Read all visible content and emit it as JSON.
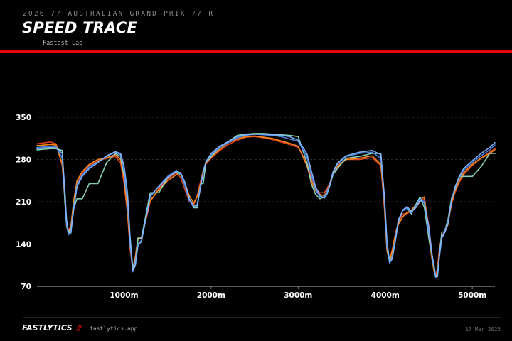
{
  "header": {
    "supertitle": "2026 // AUSTRALIAN GRAND PRIX // R",
    "title": "SPEED TRACE",
    "subtitle": "Fastest Lap"
  },
  "footer": {
    "brand": "FASTLYTICS",
    "separator": "//",
    "site": "fastlytics.app",
    "date": "17 Mar 2026"
  },
  "colors": {
    "background": "#000000",
    "accent": "#e10600",
    "grid": "#3a3a3a"
  },
  "chart_data": {
    "type": "line",
    "title": "",
    "xlabel": "",
    "ylabel": "",
    "xlim": [
      0,
      5260
    ],
    "ylim": [
      70,
      350
    ],
    "yticks": [
      70,
      140,
      210,
      280,
      350
    ],
    "xticks": [
      1000,
      2000,
      3000,
      4000,
      5000
    ],
    "xtick_labels": [
      "1000m",
      "2000m",
      "3000m",
      "4000m",
      "5000m"
    ],
    "grid": "horizontal dashed",
    "legend": "none",
    "series": [
      {
        "color": "#e8461e",
        "x": [
          0,
          150,
          220,
          290,
          320,
          340,
          360,
          390,
          420,
          460,
          520,
          600,
          700,
          800,
          900,
          960,
          1000,
          1040,
          1070,
          1100,
          1130,
          1160,
          1200,
          1300,
          1400,
          1500,
          1600,
          1650,
          1700,
          1750,
          1800,
          1840,
          1880,
          1910,
          1940,
          2000,
          2100,
          2200,
          2300,
          2400,
          2500,
          2600,
          2700,
          2800,
          2900,
          3000,
          3100,
          3150,
          3200,
          3250,
          3300,
          3330,
          3360,
          3400,
          3450,
          3550,
          3700,
          3850,
          3950,
          3990,
          4020,
          4050,
          4080,
          4120,
          4150,
          4200,
          4250,
          4300,
          4350,
          4400,
          4450,
          4500,
          4540,
          4560,
          4580,
          4600,
          4620,
          4650,
          4680,
          4720,
          4760,
          4800,
          4850,
          4900,
          5000,
          5100,
          5200,
          5260
        ],
        "values": [
          306,
          309,
          306,
          270,
          215,
          180,
          162,
          170,
          205,
          240,
          258,
          270,
          278,
          282,
          285,
          275,
          240,
          190,
          130,
          100,
          120,
          150,
          148,
          210,
          232,
          248,
          258,
          250,
          230,
          210,
          205,
          220,
          245,
          262,
          272,
          282,
          295,
          305,
          312,
          317,
          318,
          316,
          313,
          309,
          305,
          300,
          275,
          250,
          232,
          225,
          225,
          232,
          240,
          258,
          270,
          280,
          280,
          283,
          270,
          200,
          130,
          115,
          130,
          160,
          175,
          190,
          190,
          195,
          200,
          210,
          215,
          170,
          120,
          100,
          88,
          100,
          130,
          155,
          160,
          175,
          205,
          225,
          242,
          255,
          270,
          282,
          292,
          298
        ]
      },
      {
        "color": "#ff8c1a",
        "x": [
          0,
          150,
          220,
          290,
          320,
          340,
          360,
          390,
          420,
          460,
          520,
          600,
          700,
          800,
          900,
          960,
          1000,
          1040,
          1070,
          1100,
          1130,
          1160,
          1200,
          1300,
          1400,
          1500,
          1600,
          1650,
          1700,
          1750,
          1800,
          1840,
          1880,
          1910,
          1940,
          2000,
          2100,
          2200,
          2300,
          2400,
          2500,
          2600,
          2700,
          2800,
          2900,
          3000,
          3100,
          3150,
          3200,
          3250,
          3300,
          3330,
          3360,
          3400,
          3450,
          3550,
          3700,
          3850,
          3950,
          3990,
          4020,
          4050,
          4080,
          4120,
          4150,
          4200,
          4250,
          4300,
          4350,
          4400,
          4450,
          4500,
          4540,
          4560,
          4580,
          4600,
          4620,
          4650,
          4680,
          4720,
          4760,
          4800,
          4850,
          4900,
          5000,
          5100,
          5200,
          5260
        ],
        "values": [
          303,
          305,
          304,
          273,
          220,
          178,
          160,
          168,
          210,
          245,
          260,
          272,
          280,
          283,
          288,
          280,
          250,
          195,
          135,
          98,
          115,
          148,
          150,
          212,
          230,
          245,
          255,
          258,
          240,
          220,
          208,
          218,
          240,
          262,
          275,
          284,
          297,
          308,
          314,
          318,
          319,
          317,
          315,
          311,
          307,
          302,
          270,
          245,
          228,
          222,
          220,
          228,
          238,
          256,
          268,
          280,
          282,
          286,
          272,
          205,
          128,
          112,
          128,
          158,
          172,
          185,
          192,
          196,
          205,
          213,
          218,
          150,
          112,
          95,
          86,
          92,
          125,
          150,
          158,
          172,
          208,
          228,
          245,
          258,
          272,
          282,
          290,
          296
        ]
      },
      {
        "color": "#8fd9c0",
        "x": [
          0,
          150,
          220,
          290,
          320,
          340,
          360,
          390,
          420,
          460,
          520,
          600,
          700,
          800,
          900,
          960,
          1000,
          1040,
          1070,
          1100,
          1130,
          1160,
          1200,
          1300,
          1400,
          1500,
          1600,
          1650,
          1700,
          1750,
          1800,
          1840,
          1880,
          1910,
          1940,
          2000,
          2100,
          2200,
          2300,
          2400,
          2500,
          2600,
          2700,
          2800,
          2900,
          3000,
          3100,
          3150,
          3200,
          3250,
          3300,
          3330,
          3360,
          3400,
          3450,
          3550,
          3700,
          3850,
          3950,
          3990,
          4020,
          4050,
          4080,
          4120,
          4150,
          4200,
          4250,
          4300,
          4350,
          4400,
          4450,
          4500,
          4540,
          4560,
          4580,
          4600,
          4620,
          4650,
          4680,
          4720,
          4760,
          4800,
          4850,
          4900,
          5000,
          5100,
          5200,
          5260
        ],
        "values": [
          296,
          298,
          298,
          295,
          210,
          170,
          158,
          165,
          198,
          215,
          215,
          240,
          240,
          275,
          290,
          285,
          255,
          210,
          150,
          100,
          112,
          150,
          150,
          225,
          225,
          250,
          260,
          255,
          240,
          215,
          200,
          200,
          240,
          240,
          275,
          285,
          300,
          310,
          320,
          322,
          323,
          323,
          322,
          321,
          320,
          318,
          275,
          240,
          222,
          215,
          218,
          225,
          235,
          255,
          265,
          282,
          285,
          290,
          290,
          215,
          135,
          110,
          120,
          150,
          180,
          195,
          200,
          190,
          205,
          218,
          200,
          150,
          120,
          105,
          85,
          90,
          120,
          160,
          160,
          180,
          215,
          230,
          252,
          252,
          252,
          268,
          290,
          290
        ]
      },
      {
        "color": "#4f86ea",
        "x": [
          0,
          150,
          220,
          290,
          320,
          340,
          360,
          390,
          420,
          460,
          520,
          600,
          700,
          800,
          900,
          960,
          1000,
          1040,
          1070,
          1100,
          1130,
          1160,
          1200,
          1300,
          1400,
          1500,
          1600,
          1650,
          1700,
          1750,
          1800,
          1840,
          1880,
          1910,
          1940,
          2000,
          2100,
          2200,
          2300,
          2400,
          2500,
          2600,
          2700,
          2800,
          2900,
          3000,
          3100,
          3150,
          3200,
          3250,
          3300,
          3330,
          3360,
          3400,
          3450,
          3550,
          3700,
          3850,
          3950,
          3990,
          4020,
          4050,
          4080,
          4120,
          4150,
          4200,
          4250,
          4300,
          4350,
          4400,
          4450,
          4500,
          4540,
          4560,
          4580,
          4600,
          4620,
          4650,
          4680,
          4720,
          4760,
          4800,
          4850,
          4900,
          5000,
          5100,
          5200,
          5260
        ],
        "values": [
          300,
          302,
          301,
          282,
          225,
          175,
          155,
          160,
          200,
          238,
          255,
          268,
          276,
          285,
          292,
          288,
          262,
          210,
          140,
          94,
          108,
          140,
          146,
          218,
          236,
          252,
          262,
          256,
          236,
          212,
          202,
          206,
          238,
          260,
          276,
          288,
          300,
          308,
          316,
          320,
          322,
          321,
          320,
          318,
          314,
          310,
          285,
          255,
          230,
          218,
          218,
          226,
          238,
          258,
          272,
          285,
          290,
          292,
          282,
          212,
          138,
          108,
          118,
          152,
          178,
          195,
          200,
          192,
          202,
          215,
          210,
          160,
          118,
          100,
          84,
          88,
          118,
          152,
          160,
          176,
          212,
          232,
          250,
          262,
          275,
          286,
          296,
          304
        ]
      },
      {
        "color": "#7fb6ff",
        "x": [
          0,
          150,
          220,
          290,
          320,
          340,
          360,
          390,
          420,
          460,
          520,
          600,
          700,
          800,
          900,
          960,
          1000,
          1040,
          1070,
          1100,
          1130,
          1160,
          1200,
          1300,
          1400,
          1500,
          1600,
          1650,
          1700,
          1750,
          1800,
          1840,
          1880,
          1910,
          1940,
          2000,
          2100,
          2200,
          2300,
          2400,
          2500,
          2600,
          2700,
          2800,
          2900,
          3000,
          3100,
          3150,
          3200,
          3250,
          3300,
          3330,
          3360,
          3400,
          3450,
          3550,
          3700,
          3850,
          3950,
          3990,
          4020,
          4050,
          4080,
          4120,
          4150,
          4200,
          4250,
          4300,
          4350,
          4400,
          4450,
          4500,
          4540,
          4560,
          4580,
          4600,
          4620,
          4650,
          4680,
          4720,
          4760,
          4800,
          4850,
          4900,
          5000,
          5100,
          5200,
          5260
        ],
        "values": [
          298,
          300,
          299,
          290,
          230,
          180,
          160,
          158,
          195,
          235,
          252,
          265,
          275,
          286,
          293,
          290,
          270,
          225,
          150,
          96,
          104,
          138,
          144,
          220,
          235,
          250,
          260,
          258,
          242,
          215,
          203,
          203,
          235,
          258,
          276,
          290,
          302,
          310,
          318,
          321,
          322,
          322,
          321,
          320,
          318,
          312,
          290,
          262,
          235,
          220,
          216,
          222,
          236,
          260,
          274,
          286,
          292,
          295,
          288,
          220,
          145,
          110,
          115,
          148,
          176,
          196,
          202,
          194,
          200,
          212,
          208,
          168,
          120,
          102,
          86,
          86,
          116,
          150,
          158,
          174,
          210,
          234,
          252,
          265,
          278,
          290,
          300,
          308
        ]
      }
    ]
  }
}
